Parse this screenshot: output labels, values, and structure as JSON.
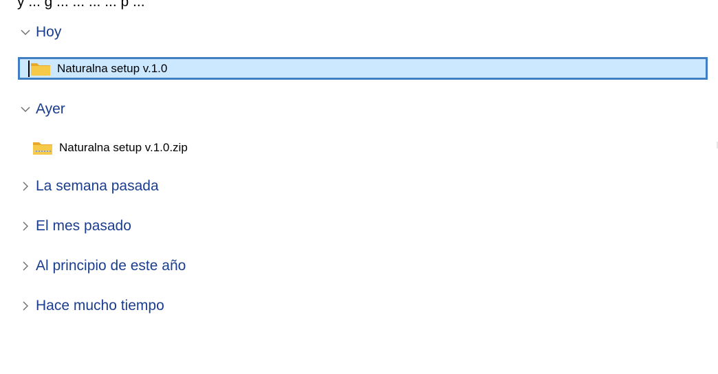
{
  "top_cut_text": "y ... g ... ... ... ... p ...",
  "groups": [
    {
      "label": "Hoy",
      "expanded": true,
      "items": [
        {
          "name": "Naturalna setup v.1.0",
          "icon": "folder-icon",
          "selected": true
        }
      ]
    },
    {
      "label": "Ayer",
      "expanded": true,
      "items": [
        {
          "name": "Naturalna setup v.1.0.zip",
          "icon": "zip-folder-icon",
          "selected": false
        }
      ]
    },
    {
      "label": "La semana pasada",
      "expanded": false
    },
    {
      "label": "El mes pasado",
      "expanded": false
    },
    {
      "label": "Al principio de este año",
      "expanded": false
    },
    {
      "label": "Hace mucho tiempo",
      "expanded": false
    }
  ],
  "colors": {
    "group_label": "#1a3d8f",
    "selection_fill": "#cce8ff",
    "selection_border": "#3f7fc2",
    "folder_yellow": "#f7c948"
  }
}
